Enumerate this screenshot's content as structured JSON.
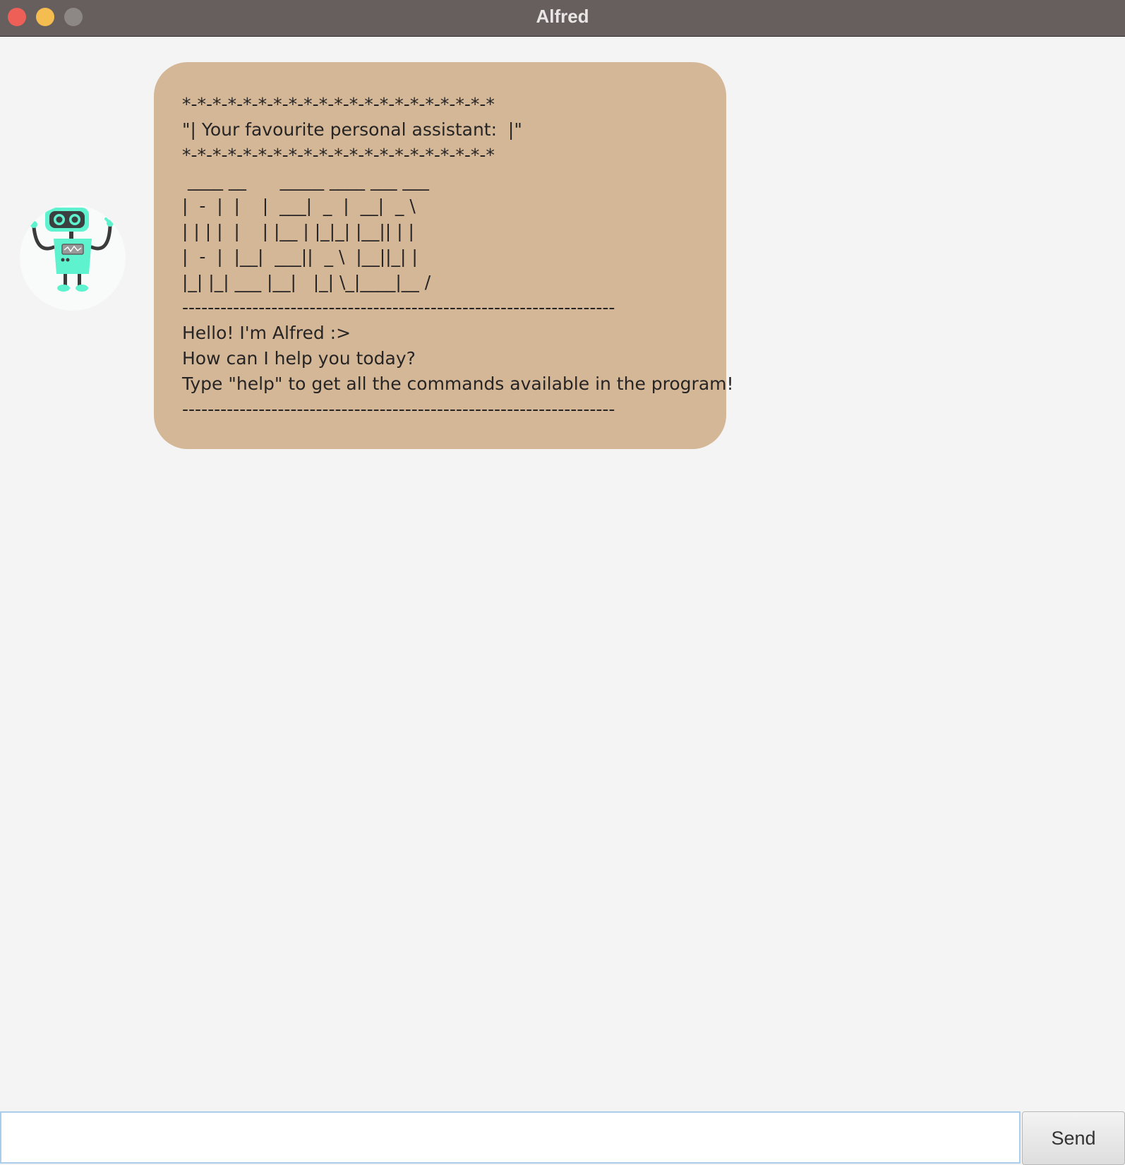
{
  "window": {
    "title": "Alfred"
  },
  "chat": {
    "messages": [
      {
        "sender": "bot",
        "avatar_icon": "robot-icon",
        "text": "*-*-*-*-*-*-*-*-*-*-*-*-*-*-*-*-*-*-*-*-*\n\"| Your favourite personal assistant:  |\"\n*-*-*-*-*-*-*-*-*-*-*-*-*-*-*-*-*-*-*-*-*\n ____ __      _____ ____ ___ ___\n|  -  |  |    |  ___|  _  |  __|  _ \\\n| | | |  |    | |__ | |_|_| |__|| | |\n|  -  |  |__|  ___||  _ \\  |__||_| |\n|_| |_| ___ |__|   |_| \\_|____|__ /\n--------------------------------------------------------------------\nHello! I'm Alfred :>\nHow can I help you today?\nType \"help\" to get all the commands available in the program!\n--------------------------------------------------------------------"
      }
    ]
  },
  "input": {
    "value": "",
    "placeholder": ""
  },
  "send_button": {
    "label": "Send"
  },
  "colors": {
    "titlebar": "#675f5e",
    "background": "#f4f4f4",
    "bubble": "#d4b797",
    "robot_body": "#5ef2cf",
    "input_focus_border": "#a9cdea"
  }
}
